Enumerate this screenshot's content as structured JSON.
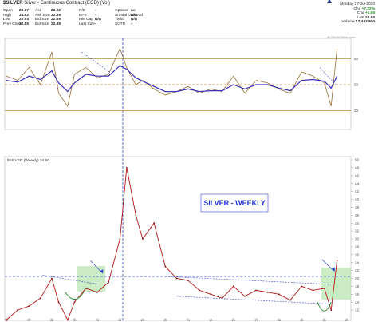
{
  "header": {
    "symbol": "$SILVER",
    "description": "Silver - Continuous Contract (EOD) (Vol)",
    "rows": [
      [
        {
          "k": "Open",
          "v": "22.87"
        },
        {
          "k": "Ask",
          "v": "22.92"
        },
        {
          "k": "P/E",
          "v": "-"
        },
        {
          "k": "Options",
          "v": "no"
        }
      ],
      [
        {
          "k": "High",
          "v": "24.82"
        },
        {
          "k": "Ask Size",
          "v": "22.89"
        },
        {
          "k": "EPS",
          "v": "-"
        },
        {
          "k": "Annual Dividend",
          "v": "N/A"
        }
      ],
      [
        {
          "k": "Low",
          "v": "22.94"
        },
        {
          "k": "Bid Size",
          "v": "22.89"
        },
        {
          "k": "Mkt Cap",
          "v": "N/A"
        },
        {
          "k": "Yield",
          "v": "N/A"
        }
      ],
      [
        {
          "k": "Prev Close",
          "v": "22.85"
        },
        {
          "k": "Bid Size",
          "v": "22.89"
        },
        {
          "k": "Last Size",
          "v": "-"
        },
        {
          "k": "SCTR",
          "v": "-"
        }
      ]
    ],
    "right": [
      {
        "k": "Monday 27-Jul-2020",
        "v": ""
      },
      {
        "k": "Chg",
        "v": "+7.22%"
      },
      {
        "k": "Chg",
        "v": "+1.65"
      },
      {
        "k": "Last",
        "v": "24.50"
      },
      {
        "k": "Volume",
        "v": "17,443,800"
      }
    ],
    "watermark": "@ StockCharts.com"
  },
  "chart_data": [
    {
      "type": "line",
      "name": "top-oscillator-panel",
      "ylim": [
        0,
        100
      ],
      "reference_levels": [
        80,
        50,
        20
      ],
      "tick_labels": [
        "80",
        "50",
        "20"
      ],
      "x": [
        2006,
        2006.5,
        2007,
        2007.5,
        2008,
        2008.3,
        2008.7,
        2009,
        2009.5,
        2010,
        2010.5,
        2011,
        2011.3,
        2011.7,
        2012,
        2012.5,
        2013,
        2013.5,
        2014,
        2014.5,
        2015,
        2015.5,
        2016,
        2016.5,
        2017,
        2017.5,
        2018,
        2018.5,
        2019,
        2019.5,
        2020,
        2020.3,
        2020.56
      ],
      "series": [
        {
          "values": [
            60,
            55,
            70,
            50,
            88,
            40,
            25,
            62,
            70,
            58,
            62,
            92,
            70,
            50,
            55,
            45,
            38,
            42,
            48,
            40,
            45,
            42,
            60,
            40,
            55,
            52,
            45,
            40,
            65,
            60,
            52,
            25,
            92
          ]
        },
        {
          "values": [
            55,
            53,
            60,
            56,
            66,
            52,
            42,
            52,
            62,
            60,
            60,
            72,
            68,
            58,
            54,
            48,
            42,
            42,
            45,
            42,
            43,
            43,
            50,
            45,
            50,
            50,
            46,
            43,
            55,
            56,
            54,
            46,
            60
          ]
        }
      ]
    },
    {
      "type": "line",
      "title": "SILVER  - WEEKLY",
      "series": [
        {
          "name": "$SILVER (Weekly) 24.50",
          "values": [
            9.5,
            12,
            13,
            15,
            20,
            14,
            9.5,
            14,
            17.5,
            16.5,
            19,
            30,
            48,
            36,
            30,
            34,
            23,
            20,
            19.5,
            17,
            16,
            15,
            18,
            15.5,
            17,
            16.5,
            16,
            14.5,
            18,
            17,
            17.5,
            12,
            24.5
          ]
        }
      ],
      "x": [
        2006,
        2006.5,
        2007,
        2007.5,
        2008,
        2008.3,
        2008.7,
        2009,
        2009.5,
        2010,
        2010.5,
        2011,
        2011.3,
        2011.7,
        2012,
        2012.5,
        2013,
        2013.5,
        2014,
        2014.5,
        2015,
        2015.5,
        2016,
        2016.5,
        2017,
        2017.5,
        2018,
        2018.5,
        2019,
        2019.5,
        2020,
        2020.3,
        2020.56
      ],
      "ylim": [
        10,
        50
      ],
      "y_tick_labels": [
        "50",
        "48",
        "46",
        "44",
        "42",
        "40",
        "38",
        "36",
        "34",
        "32",
        "30",
        "28",
        "26",
        "24",
        "22",
        "20",
        "18",
        "16",
        "14",
        "12"
      ],
      "x_tick_labels": [
        "06",
        "07",
        "08",
        "09",
        "10",
        "11",
        "12",
        "13",
        "14",
        "15",
        "16",
        "17",
        "18",
        "19",
        "20",
        "21"
      ],
      "horizontal_level": 20.5
    }
  ]
}
